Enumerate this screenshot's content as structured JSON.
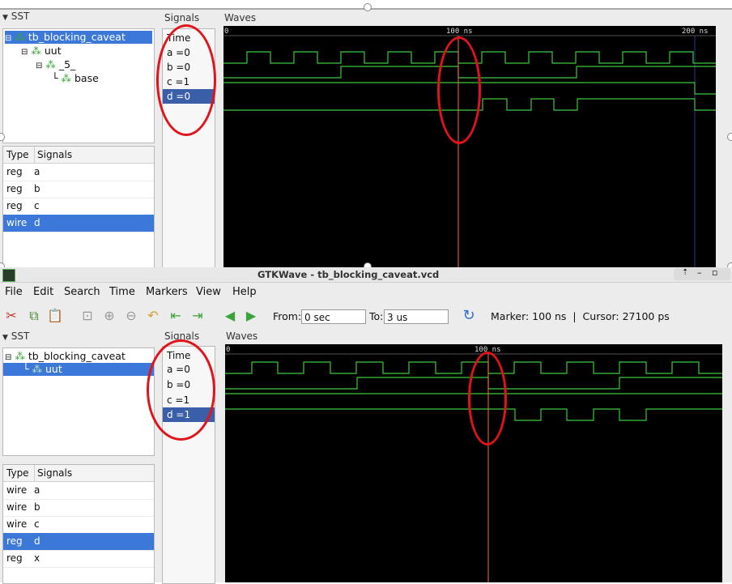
{
  "top": {
    "sst_label": "SST",
    "tree": [
      {
        "label": "tb_blocking_caveat",
        "selected": true
      },
      {
        "label": "uut",
        "selected": false
      },
      {
        "label": "_5_",
        "selected": false
      },
      {
        "label": "base",
        "selected": false
      }
    ],
    "table_headers": {
      "type": "Type",
      "signals": "Signals"
    },
    "rows": [
      {
        "type": "reg",
        "name": "a",
        "selected": false
      },
      {
        "type": "reg",
        "name": "b",
        "selected": false
      },
      {
        "type": "reg",
        "name": "c",
        "selected": false
      },
      {
        "type": "wire",
        "name": "d",
        "selected": true
      }
    ],
    "signals_title": "Signals",
    "time_label": "Time",
    "signals": [
      {
        "label": "a =0",
        "selected": false
      },
      {
        "label": "b =0",
        "selected": false
      },
      {
        "label": "c =1",
        "selected": false
      },
      {
        "label": "d =0",
        "selected": true
      }
    ],
    "waves_title": "Waves",
    "ticks": {
      "start": "0",
      "mid": "100 ns",
      "end": "200 ns"
    }
  },
  "window": {
    "title": "GTKWave - tb_blocking_caveat.vcd",
    "menu": [
      "File",
      "Edit",
      "Search",
      "Time",
      "Markers",
      "View",
      "Help"
    ],
    "from_label": "From:",
    "from_value": "0 sec",
    "to_label": "To:",
    "to_value": "3 us",
    "marker_text": "Marker: 100 ns  |  Cursor: 27100 ps"
  },
  "bottom": {
    "sst_label": "SST",
    "tree": [
      {
        "label": "tb_blocking_caveat",
        "selected": false
      },
      {
        "label": "uut",
        "selected": true
      }
    ],
    "table_headers": {
      "type": "Type",
      "signals": "Signals"
    },
    "rows": [
      {
        "type": "wire",
        "name": "a",
        "selected": false
      },
      {
        "type": "wire",
        "name": "b",
        "selected": false
      },
      {
        "type": "wire",
        "name": "c",
        "selected": false
      },
      {
        "type": "reg",
        "name": "d",
        "selected": true
      },
      {
        "type": "reg",
        "name": "x",
        "selected": false
      }
    ],
    "signals_title": "Signals",
    "time_label": "Time",
    "signals": [
      {
        "label": "a =0",
        "selected": false
      },
      {
        "label": "b =0",
        "selected": false
      },
      {
        "label": "c =1",
        "selected": false
      },
      {
        "label": "d =1",
        "selected": true
      }
    ],
    "waves_title": "Waves",
    "ticks": {
      "start": "0",
      "mid": "100 ns"
    }
  },
  "colors": {
    "wave_green": "#3cc93c",
    "cursor": "#ff6a3a",
    "annotation_red": "#e0141a",
    "selection_blue": "#3b78d8"
  }
}
